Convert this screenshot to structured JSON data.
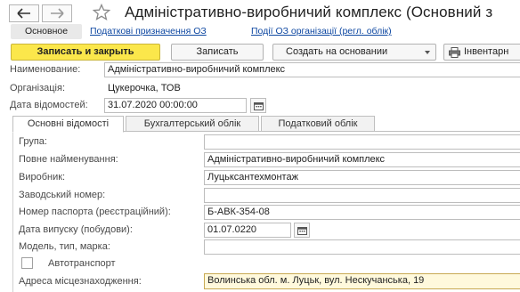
{
  "window": {
    "title": "Адміністративно-виробничий комплекс (Основний з"
  },
  "subnav": {
    "main_label": "Основное",
    "link1": "Податкові призначення ОЗ",
    "link2": "Події ОЗ організації (регл. облік)"
  },
  "toolbar": {
    "save_close": "Записать и закрыть",
    "save": "Записать",
    "create_based": "Создать на основании",
    "inventory": "Інвентарн"
  },
  "header_fields": {
    "name_label": "Наименование:",
    "name_value": "Адміністративно-виробничий комплекс",
    "org_label": "Організація:",
    "org_value": "Цукерочка, ТОВ",
    "date_label": "Дата відомостей:",
    "date_value": "31.07.2020 00:00:00"
  },
  "tabs": [
    {
      "label": "Основні відомості",
      "active": true
    },
    {
      "label": "Бухгалтерський облік",
      "active": false
    },
    {
      "label": "Податковий облік",
      "active": false
    }
  ],
  "main_tab": {
    "group_label": "Група:",
    "group_value": "",
    "full_name_label": "Повне найменування:",
    "full_name_value": "Адміністративно-виробничий комплекс",
    "manufacturer_label": "Виробник:",
    "manufacturer_value": "Луцьксантехмонтаж",
    "serial_label": "Заводський номер:",
    "serial_value": "",
    "passport_label": "Номер паспорта (реєстраційний):",
    "passport_value": "Б-АВК-354-08",
    "release_label": "Дата випуску (побудови):",
    "release_value": "01.07.0220",
    "model_label": "Модель, тип, марка:",
    "model_value": "",
    "vehicle_label": "Автотранспорт",
    "vehicle_checked": false,
    "address_label": "Адреса місцезнаходження:",
    "address_value": "Волинська обл. м. Луцьк, вул. Нескучанська, 19"
  },
  "colors": {
    "primary_button": "#fbe74b",
    "link": "#0d47a1",
    "address_field_bg": "#fff9dc"
  },
  "icons": [
    "back-arrow-icon",
    "forward-arrow-icon",
    "star-icon",
    "calendar-icon",
    "printer-icon",
    "dropdown-arrow-icon"
  ]
}
